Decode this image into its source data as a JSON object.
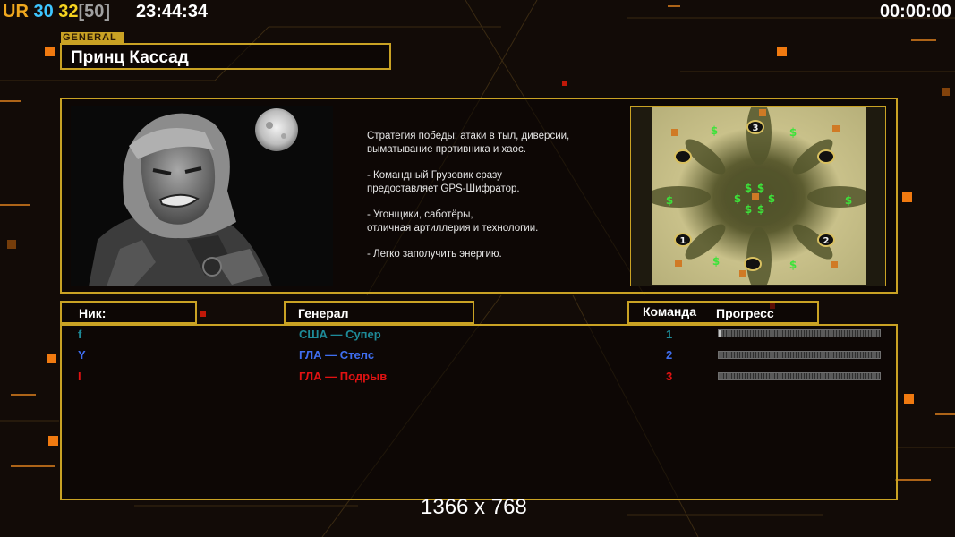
{
  "hud": {
    "ur_label": "UR",
    "fps": "30",
    "fps2": "32",
    "fps_cap": "[50]",
    "clock": "23:44:34",
    "match_timer": "00:00:00",
    "colors": {
      "ur": "#f0a81e",
      "fps": "#3ec6ff",
      "fps2": "#f5d21f",
      "cap": "#a0a0a0"
    }
  },
  "general": {
    "tag": "GENERAL",
    "name": "Принц Кассад",
    "description": [
      "Стратегия победы: атаки в тыл, диверсии,\n выматывание противника и хаос.",
      "- Командный Грузовик сразу\nпредоставляет GPS-Шифратор.",
      "- Угонщики, саботёры,\nотличная артиллерия и технологии.",
      "- Легко заполучить энергию."
    ]
  },
  "map": {
    "start_markers": [
      "3",
      "1",
      "2"
    ]
  },
  "table": {
    "headers": {
      "nick": "Ник:",
      "general": "Генерал",
      "team": "Команда",
      "progress": "Прогресс"
    },
    "players": [
      {
        "nick": "f",
        "general": "США — Супер",
        "team": "1",
        "progress": 0.01,
        "color": "#1e8a98"
      },
      {
        "nick": "Y",
        "general": "ГЛА — Стелс",
        "team": "2",
        "progress": 0,
        "color": "#3f6ef0"
      },
      {
        "nick": "I",
        "general": "ГЛА — Подрыв",
        "team": "3",
        "progress": 0,
        "color": "#e01212"
      }
    ]
  },
  "resolution": "1366 x 768",
  "theme": {
    "accent": "#c9a224",
    "background": "#120b07"
  }
}
